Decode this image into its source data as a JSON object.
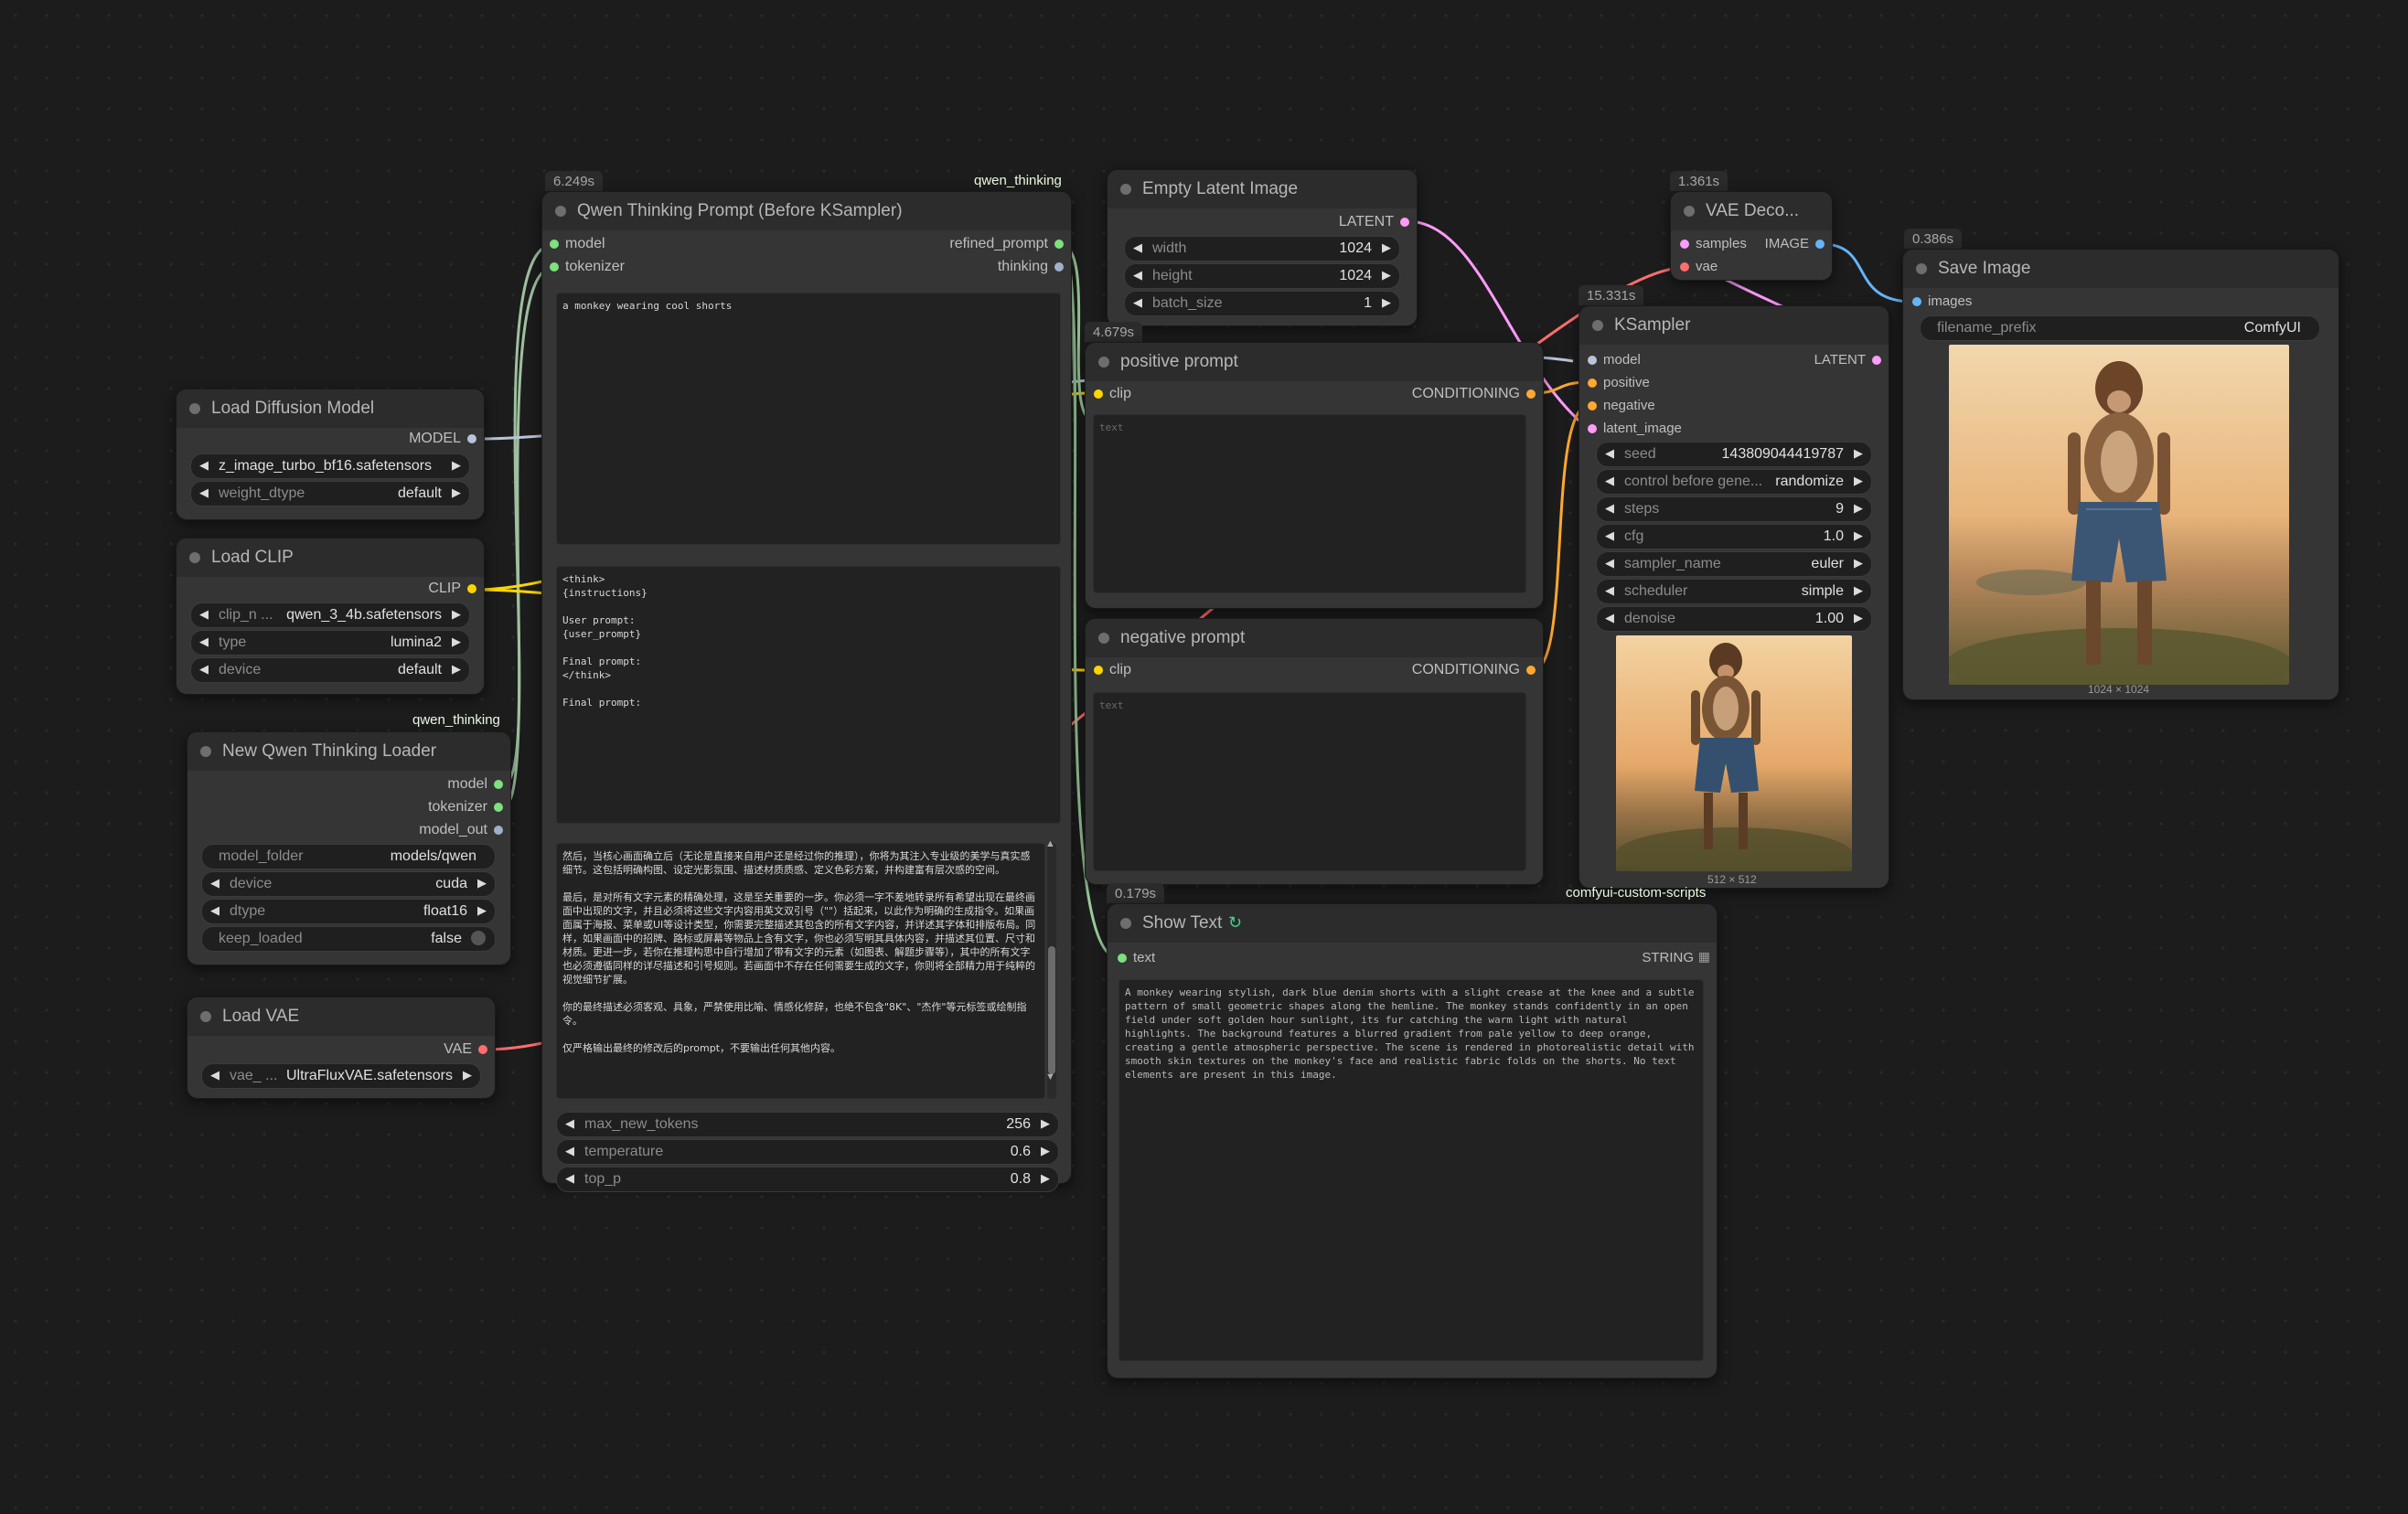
{
  "colors": {
    "model": "#b3d9b3",
    "clip": "#ffd500",
    "vae": "#ff6e6e",
    "latent": "#ff9cf9",
    "conditioning": "#ffa931",
    "image": "#64b5f6",
    "string": "#7ee07e",
    "text_wire": "#9ccc9c"
  },
  "qwen_prompt": {
    "badge": "6.249s",
    "tag": "qwen_thinking",
    "title": "Qwen Thinking Prompt (Before KSampler)",
    "in_model": "model",
    "in_tokenizer": "tokenizer",
    "out_refined": "refined_prompt",
    "out_thinking": "thinking",
    "user_text": "a monkey wearing cool shorts",
    "template_text": "<think>\n{instructions}\n\nUser prompt:\n{user_prompt}\n\nFinal prompt:\n</think>\n\nFinal prompt:",
    "instructions_text": "然后，当核心画面确立后（无论是直接来自用户还是经过你的推理），你将为其注入专业级的美学与真实感细节。这包括明确构图、设定光影氛围、描述材质质感、定义色彩方案，并构建富有层次感的空间。\n\n最后，是对所有文字元素的精确处理，这是至关重要的一步。你必须一字不差地转录所有希望出现在最终画面中出现的文字，并且必须将这些文字内容用英文双引号（\"\"）括起来，以此作为明确的生成指令。如果画面属于海报、菜单或UI等设计类型，你需要完整描述其包含的所有文字内容，并详述其字体和排版布局。同样，如果画面中的招牌、路标或屏幕等物品上含有文字，你也必须写明其具体内容，并描述其位置、尺寸和材质。更进一步，若你在推理构思中自行增加了带有文字的元素（如图表、解题步骤等），其中的所有文字也必须遵循同样的详尽描述和引号规则。若画面中不存在任何需要生成的文字，你则将全部精力用于纯粹的视觉细节扩展。\n\n你的最终描述必须客观、具象，严禁使用比喻、情感化修辞，也绝不包含\"8K\"、\"杰作\"等元标签或绘制指令。\n\n仅严格输出最终的修改后的prompt，不要输出任何其他内容。",
    "max_new_tokens_label": "max_new_tokens",
    "max_new_tokens": "256",
    "temperature_label": "temperature",
    "temperature": "0.6",
    "top_p_label": "top_p",
    "top_p": "0.8"
  },
  "load_diffusion": {
    "title": "Load Diffusion Model",
    "out": "MODEL",
    "unet_name": "z_image_turbo_bf16.safetensors",
    "weight_dtype_label": "weight_dtype",
    "weight_dtype": "default"
  },
  "load_clip": {
    "title": "Load CLIP",
    "out": "CLIP",
    "clip_name_label": "clip_n ...",
    "clip_name": "qwen_3_4b.safetensors",
    "type_label": "type",
    "type": "lumina2",
    "device_label": "device",
    "device": "default"
  },
  "qwen_loader": {
    "tag": "qwen_thinking",
    "title": "New Qwen Thinking Loader",
    "out_model": "model",
    "out_tokenizer": "tokenizer",
    "out_model_out": "model_out",
    "model_folder_label": "model_folder",
    "model_folder": "models/qwen",
    "device_label": "device",
    "device": "cuda",
    "dtype_label": "dtype",
    "dtype": "float16",
    "keep_loaded_label": "keep_loaded",
    "keep_loaded": "false"
  },
  "load_vae": {
    "title": "Load VAE",
    "out": "VAE",
    "vae_name_label": "vae_ ...",
    "vae_name": "UltraFluxVAE.safetensors"
  },
  "empty_latent": {
    "title": "Empty Latent Image",
    "out": "LATENT",
    "width_label": "width",
    "width": "1024",
    "height_label": "height",
    "height": "1024",
    "batch_label": "batch_size",
    "batch": "1"
  },
  "positive": {
    "badge": "4.679s",
    "title": "positive prompt",
    "in_clip": "clip",
    "out": "CONDITIONING",
    "placeholder": "text"
  },
  "negative": {
    "title": "negative prompt",
    "in_clip": "clip",
    "out": "CONDITIONING",
    "placeholder": "text"
  },
  "vae_decode": {
    "badge": "1.361s",
    "title": "VAE Deco...",
    "in_samples": "samples",
    "in_vae": "vae",
    "out": "IMAGE"
  },
  "ksampler": {
    "badge": "15.331s",
    "title": "KSampler",
    "in_model": "model",
    "in_positive": "positive",
    "in_negative": "negative",
    "in_latent": "latent_image",
    "out": "LATENT",
    "seed_label": "seed",
    "seed": "143809044419787",
    "control_label": "control before gene...",
    "control": "randomize",
    "steps_label": "steps",
    "steps": "9",
    "cfg_label": "cfg",
    "cfg": "1.0",
    "sampler_label": "sampler_name",
    "sampler": "euler",
    "scheduler_label": "scheduler",
    "scheduler": "simple",
    "denoise_label": "denoise",
    "denoise": "1.00",
    "preview_caption": "512 × 512"
  },
  "save_image": {
    "badge": "0.386s",
    "title": "Save Image",
    "in_images": "images",
    "prefix_label": "filename_prefix",
    "prefix": "ComfyUI",
    "caption": "1024 × 1024"
  },
  "show_text": {
    "badge": "0.179s",
    "tag": "comfyui-custom-scripts",
    "title": "Show Text",
    "in_text": "text",
    "out": "STRING",
    "content": "A monkey wearing stylish, dark blue denim shorts with a slight crease at the knee and a subtle pattern of small geometric shapes along the hemline. The monkey stands confidently in an open field under soft golden hour sunlight, its fur catching the warm light with natural highlights. The background features a blurred gradient from pale yellow to deep orange, creating a gentle atmospheric perspective. The scene is rendered in photorealistic detail with smooth skin textures on the monkey's face and realistic fabric folds on the shorts. No text elements are present in this image."
  }
}
